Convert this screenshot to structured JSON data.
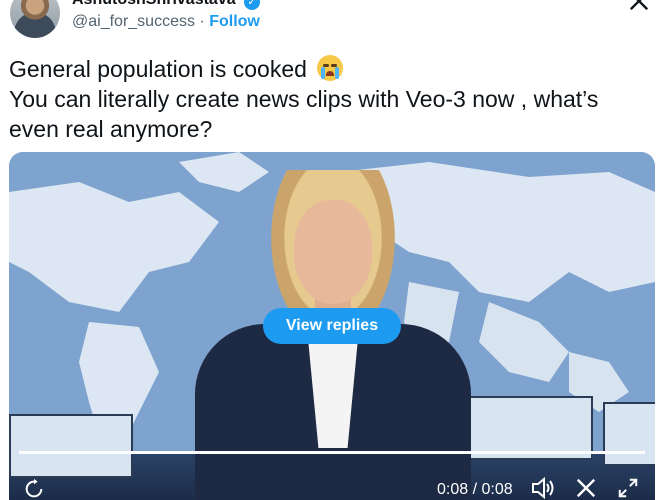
{
  "author": {
    "display_name": "AshutoshShrivastava",
    "handle": "@ai_for_success",
    "separator": "·",
    "follow_label": "Follow",
    "verified": true
  },
  "tweet": {
    "line1": "General population is cooked",
    "line2": "You can literally create news clips with Veo-3 now , what’s even real anymore?",
    "emoji": "loudly-crying-face"
  },
  "video": {
    "view_replies_label": "View replies",
    "time_display": "0:08 / 0:08",
    "progress": 1.0,
    "controls": [
      "replay-icon",
      "volume-icon",
      "x-logo-icon",
      "fullscreen-icon"
    ]
  },
  "colors": {
    "accent": "#1d9bf0",
    "text": "#0f1419",
    "muted": "#536471"
  }
}
